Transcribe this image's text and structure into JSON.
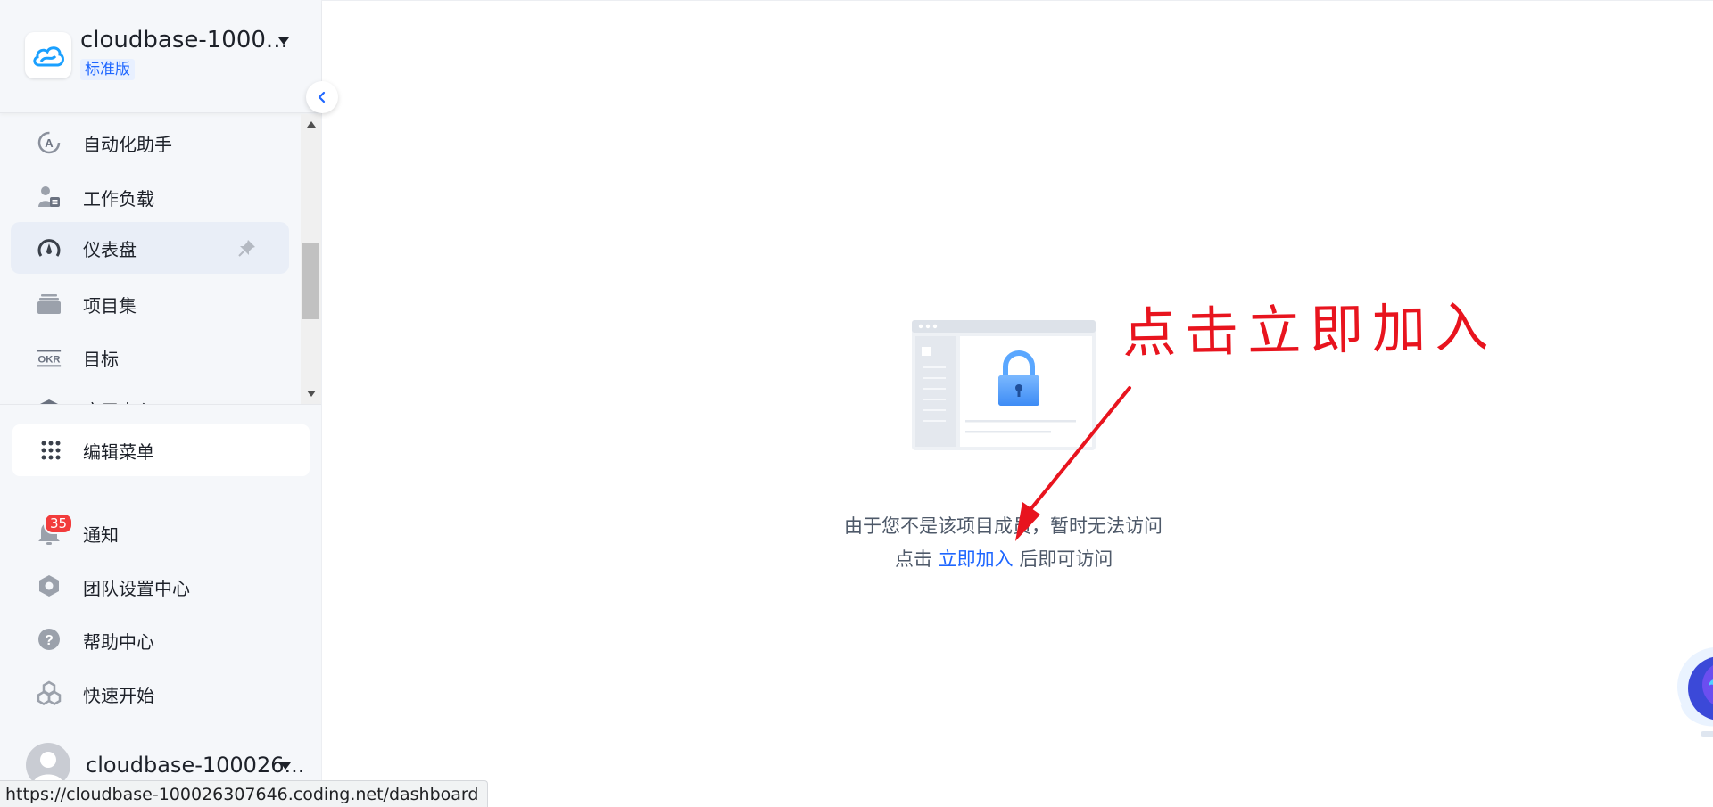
{
  "sidebar": {
    "team": {
      "name": "cloudbase-1000...",
      "plan_badge": "标准版"
    },
    "nav_items": [
      {
        "label": "自动化助手",
        "icon": "automation-icon"
      },
      {
        "label": "工作负载",
        "icon": "workload-icon"
      },
      {
        "label": "仪表盘",
        "icon": "dashboard-icon",
        "active": true,
        "pinned": true
      },
      {
        "label": "项目集",
        "icon": "project-set-icon"
      },
      {
        "label": "目标",
        "icon": "okr-icon"
      },
      {
        "label": "应用中心",
        "icon": "app-center-icon"
      }
    ],
    "edit_menu": {
      "label": "编辑菜单",
      "icon": "grid-dots-icon"
    },
    "bottom_items": [
      {
        "label": "通知",
        "icon": "bell-icon",
        "badge": "35"
      },
      {
        "label": "团队设置中心",
        "icon": "settings-hex-icon"
      },
      {
        "label": "帮助中心",
        "icon": "help-icon"
      },
      {
        "label": "快速开始",
        "icon": "quick-start-icon"
      }
    ],
    "user": {
      "name": "cloudbase-100026..."
    }
  },
  "status_bar": {
    "url": "https://cloudbase-100026307646.coding.net/dashboard"
  },
  "main": {
    "message_line1": "由于您不是该项目成员，暂时无法访问",
    "message_line2_prefix": "点击",
    "join_link": "立即加入",
    "message_line2_suffix": "后即可访问"
  },
  "annotation": {
    "text": "点击立即加入",
    "color": "#e8141e"
  },
  "colors": {
    "accent": "#1e66ff",
    "notification_badge": "#f23c3c",
    "sidebar_bg": "#f5f7fa"
  }
}
